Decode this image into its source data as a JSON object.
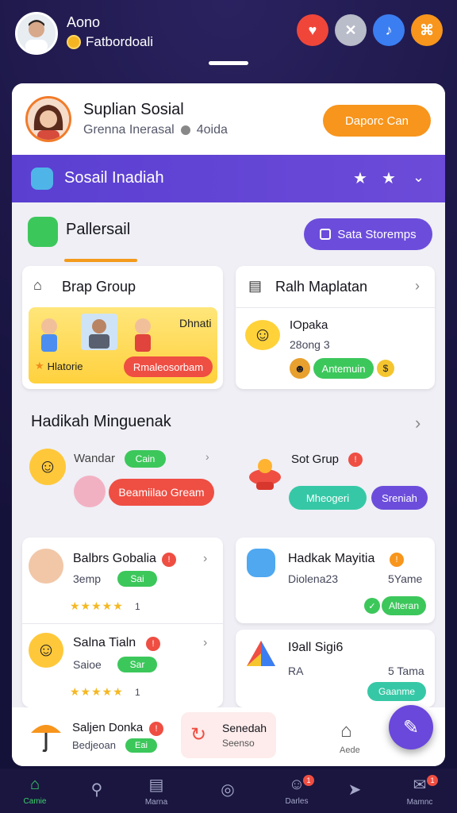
{
  "topbar": {
    "name": "Aono",
    "subtitle": "Fatbordoali",
    "icons": [
      {
        "name": "heart-icon",
        "color": "#f0463a",
        "glyph": "♥"
      },
      {
        "name": "share-icon",
        "color": "#c9ccd8",
        "glyph": "✕"
      },
      {
        "name": "music-icon",
        "color": "#3b7ef2",
        "glyph": "♪"
      },
      {
        "name": "game-icon",
        "color": "#f7951c",
        "glyph": "⌘"
      }
    ]
  },
  "header": {
    "title": "Suplian Sosial",
    "subtitle": "Grenna Inerasal",
    "count": "4oida",
    "button": "Daporc Can"
  },
  "band": {
    "title": "Sosail Inadiah"
  },
  "section1": {
    "title": "Pallersail",
    "button": "Sata Storemps"
  },
  "group_card": {
    "title": "Brap Group",
    "banner_text": "Dhnati",
    "label": "Hlatorie",
    "button": "Rmaleosorbam"
  },
  "map_card": {
    "title": "Ralh Maplatan",
    "name": "IOpaka",
    "sub": "28ong 3",
    "pill": "Antemuin"
  },
  "section2": {
    "title": "Hadikah Minguenak"
  },
  "left_feature": {
    "label": "Wandar",
    "pill": "Cain",
    "button": "Beamiilao Gream"
  },
  "right_feature": {
    "label": "Sot Grup",
    "pill1": "Mheogeri",
    "pill2": "Sreniah"
  },
  "list_left": [
    {
      "name": "Balbrs Gobalia",
      "sub": "3emp",
      "pill": "Sai",
      "rating": "1"
    },
    {
      "name": "Salna Tialn",
      "sub": "Saioe",
      "pill": "Sar",
      "rating": "1"
    }
  ],
  "list_right": [
    {
      "name": "Hadkak Mayitia",
      "sub": "Diolena23",
      "time": "5Yame",
      "pill": "Alteran"
    },
    {
      "name": "I9all Sigi6",
      "sub": "RA",
      "time": "5 Tama",
      "pill": "Gaanme"
    }
  ],
  "footer_row": {
    "name": "Saljen Donka",
    "sub": "Bedjeoan",
    "pill": "Eai",
    "center_title": "Senedah",
    "center_sub": "Seenso",
    "right_label": "Aede"
  },
  "nav": [
    {
      "label": "Camie",
      "icon": "home-icon",
      "glyph": "⌂"
    },
    {
      "label": "",
      "icon": "search-icon",
      "glyph": "⚲"
    },
    {
      "label": "Marna",
      "icon": "inbox-icon",
      "glyph": "▤"
    },
    {
      "label": "",
      "icon": "compass-icon",
      "glyph": "◎"
    },
    {
      "label": "Darles",
      "icon": "profile-icon",
      "glyph": "☺"
    },
    {
      "label": "",
      "icon": "send-icon",
      "glyph": "➤"
    },
    {
      "label": "Mamnc",
      "icon": "chat-icon",
      "glyph": "✉"
    }
  ],
  "colors": {
    "accent_orange": "#f7951c",
    "accent_purple": "#6c4ddb",
    "green": "#3cc75b",
    "red": "#ef4e43"
  }
}
